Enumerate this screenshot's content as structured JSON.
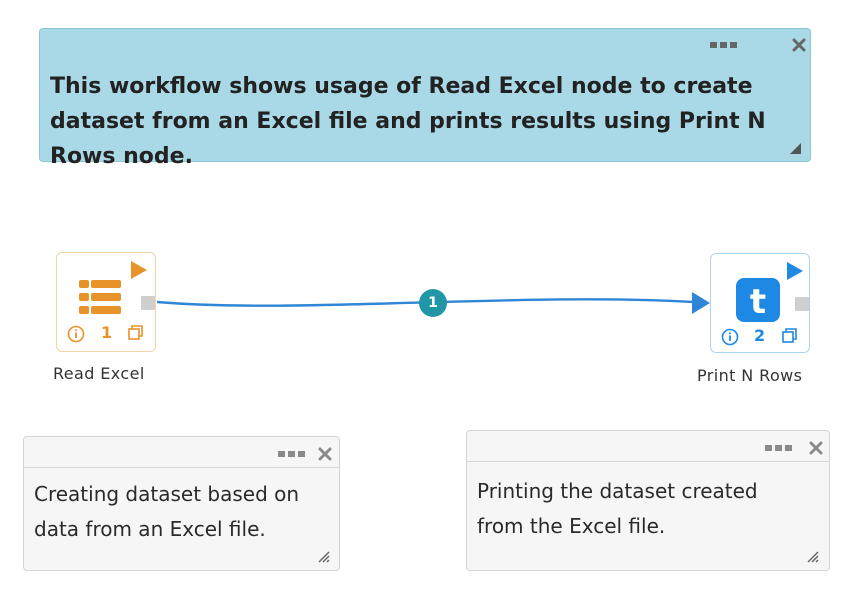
{
  "header_note": {
    "text": "This workflow shows usage of Read Excel node to create dataset from an Excel file and prints results using Print N Rows node."
  },
  "nodes": [
    {
      "label": "Read Excel",
      "number": "1",
      "icon": "table-rows-icon",
      "accent": "#e8922a"
    },
    {
      "label": "Print N Rows",
      "number": "2",
      "icon": "t-letter-icon",
      "accent": "#1e88e5"
    }
  ],
  "connection": {
    "badge": "1",
    "badge_color": "#2196a6",
    "line_color": "#2f86d6"
  },
  "notes": [
    {
      "text": "Creating dataset based on data from an Excel file."
    },
    {
      "text": "Printing the dataset created from the Excel file."
    }
  ]
}
